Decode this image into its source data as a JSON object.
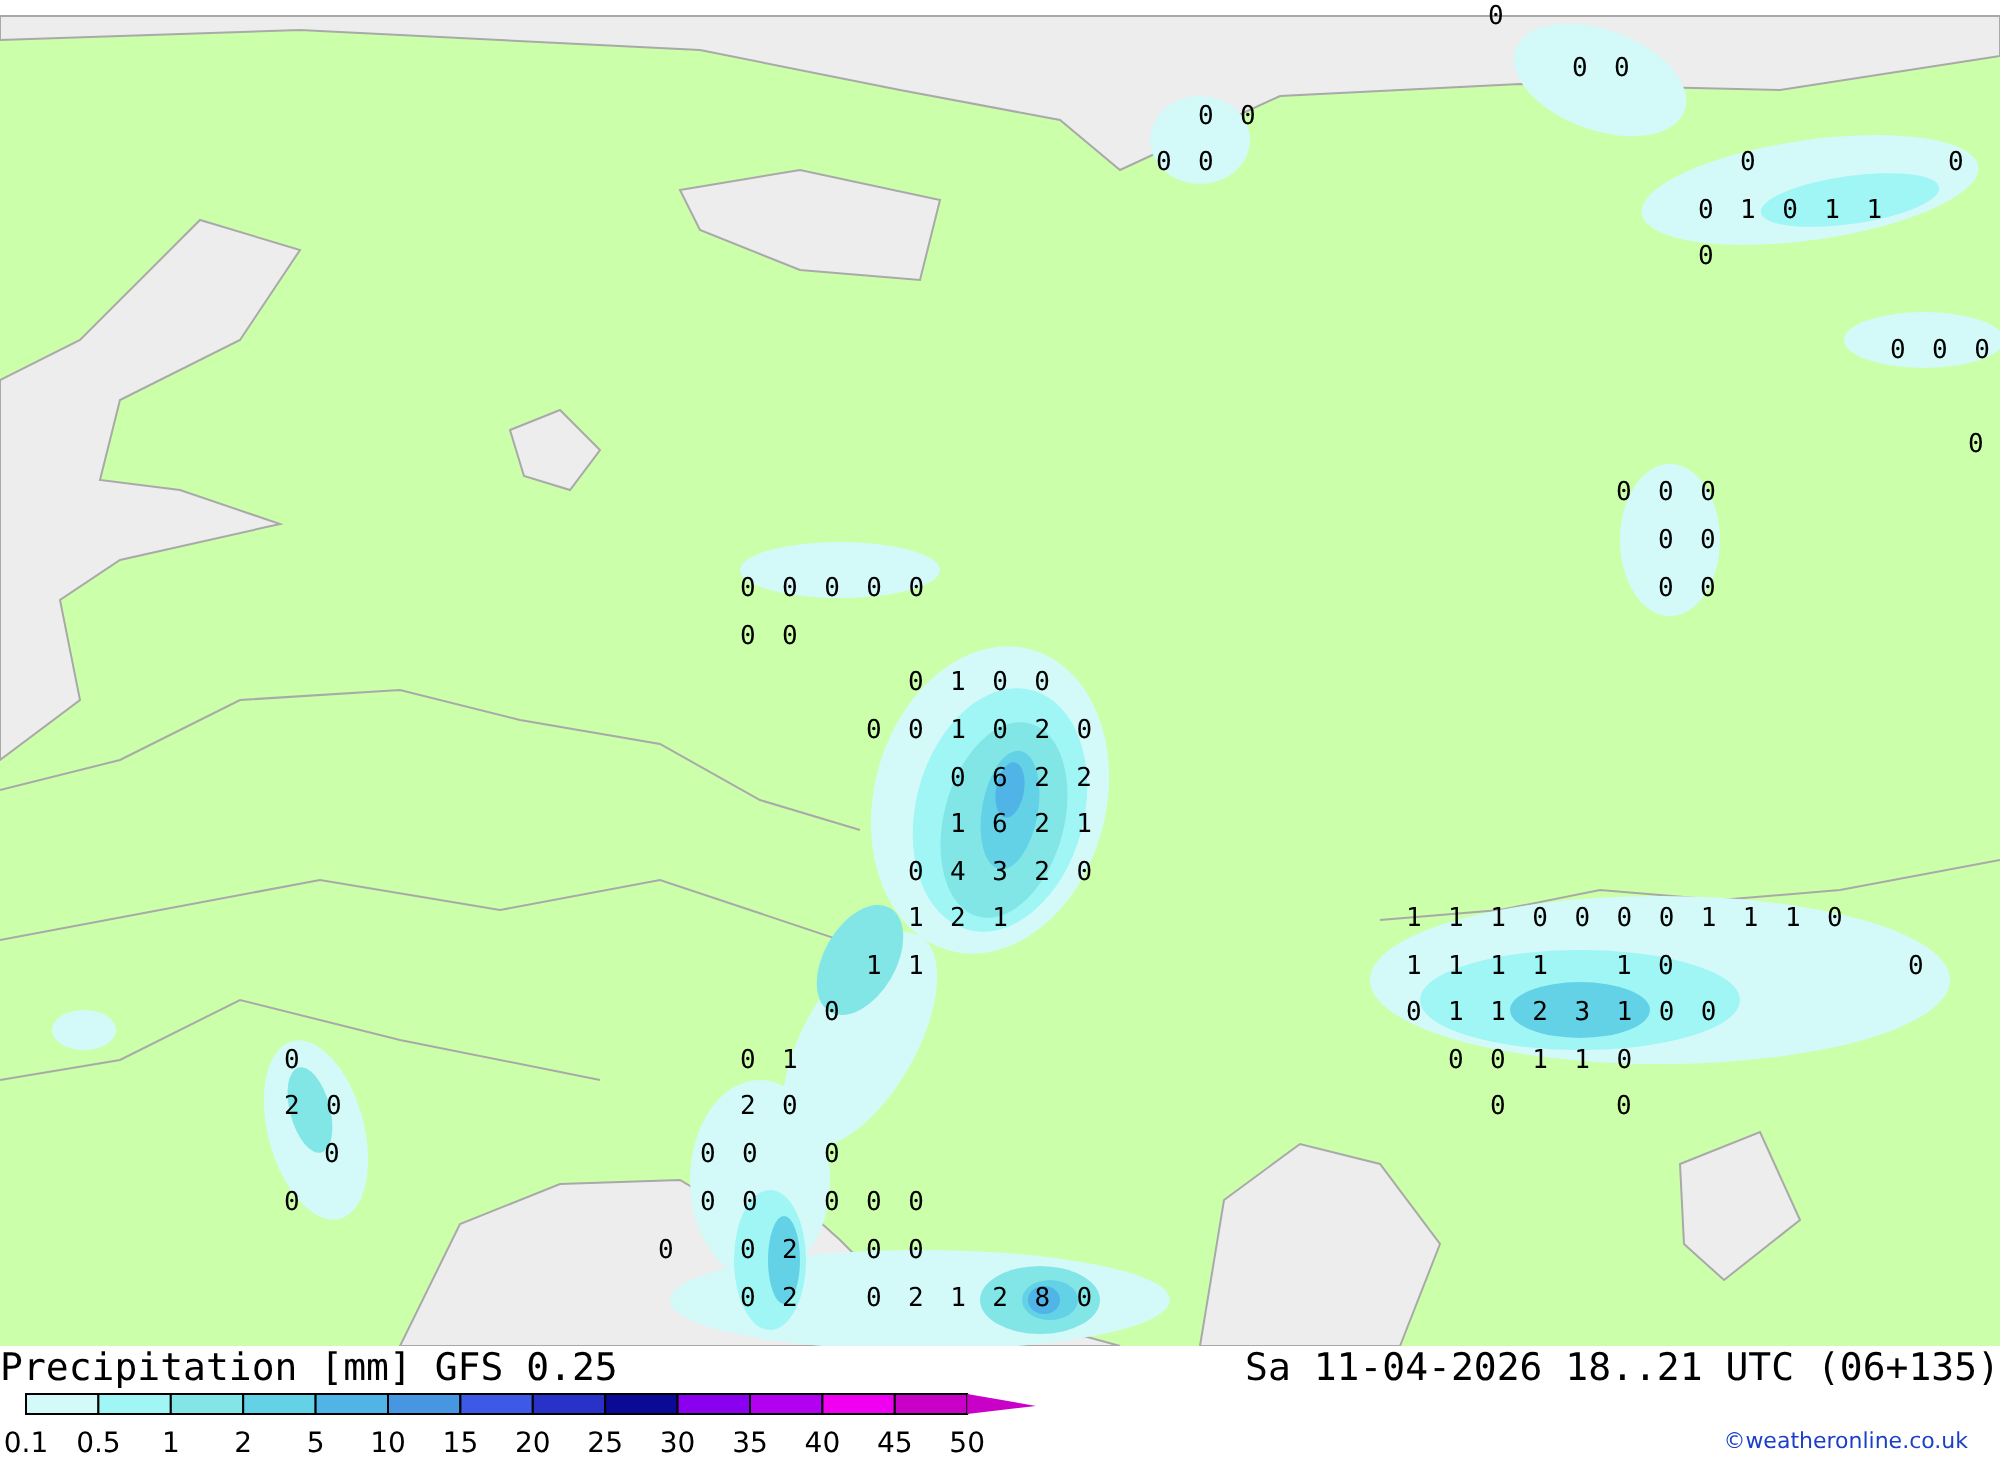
{
  "map": {
    "value_rows": [
      {
        "text": "0"
      },
      {
        "text": "0 0"
      },
      {
        "text": "0 0"
      },
      {
        "text": "0 0"
      },
      {
        "text": "0"
      },
      {
        "text": "0"
      },
      {
        "text": "0 1 0 1 1"
      },
      {
        "text": "0"
      },
      {
        "text": "0 0 0"
      },
      {
        "text": "0"
      },
      {
        "text": "0 0 0"
      },
      {
        "text": "0 0"
      },
      {
        "text": "0 0"
      },
      {
        "text": "0 0 0 0 0"
      },
      {
        "text": "0 0"
      },
      {
        "text": "0 1 0 0"
      },
      {
        "text": "0 0 1 0 2 0"
      },
      {
        "text": "0 6 2 2"
      },
      {
        "text": "1 6 2 1"
      },
      {
        "text": "0 4 3 2 0"
      },
      {
        "text": "1 2 1"
      },
      {
        "text": "1 1"
      },
      {
        "text": "0"
      },
      {
        "text": "0 1"
      },
      {
        "text": "2 0"
      },
      {
        "text": "0 0"
      },
      {
        "text": "0"
      },
      {
        "text": "0 0"
      },
      {
        "text": "0 0 0"
      },
      {
        "text": "0"
      },
      {
        "text": "0 2"
      },
      {
        "text": "0 0"
      },
      {
        "text": "0 2"
      },
      {
        "text": "0 2 1 2 8 0"
      },
      {
        "text": "0"
      },
      {
        "text": "2 0"
      },
      {
        "text": "0"
      },
      {
        "text": "0"
      },
      {
        "text": "1 1 1 0 0 0 0 1 1 1 0"
      },
      {
        "text": "1 1 1 1"
      },
      {
        "text": "1 0"
      },
      {
        "text": "0"
      },
      {
        "text": "0 1 1 2 3 1 0 0"
      },
      {
        "text": "0 0 1 1 0"
      },
      {
        "text": "0"
      },
      {
        "text": "0"
      }
    ]
  },
  "legend": {
    "title": "Precipitation [mm] GFS 0.25",
    "valid_time": "Sa 11-04-2026 18..21 UTC (06+135)",
    "bins": [
      {
        "color": "#d4f9f9"
      },
      {
        "color": "#a0f5f5"
      },
      {
        "color": "#82e6e6"
      },
      {
        "color": "#64d2e6"
      },
      {
        "color": "#50b4e6"
      },
      {
        "color": "#4696e1"
      },
      {
        "color": "#3c5ae6"
      },
      {
        "color": "#2832c8"
      },
      {
        "color": "#0a0a96"
      },
      {
        "color": "#8c00f0"
      },
      {
        "color": "#b400f0"
      },
      {
        "color": "#f000f0"
      },
      {
        "color": "#c800c8"
      }
    ],
    "scale": [
      {
        "label": "0.1"
      },
      {
        "label": "0.5"
      },
      {
        "label": "1"
      },
      {
        "label": "2"
      },
      {
        "label": "5"
      },
      {
        "label": "10"
      },
      {
        "label": "15"
      },
      {
        "label": "20"
      },
      {
        "label": "25"
      },
      {
        "label": "30"
      },
      {
        "label": "35"
      },
      {
        "label": "40"
      },
      {
        "label": "45"
      },
      {
        "label": "50"
      }
    ],
    "credit": "©weatheronline.co.uk"
  }
}
